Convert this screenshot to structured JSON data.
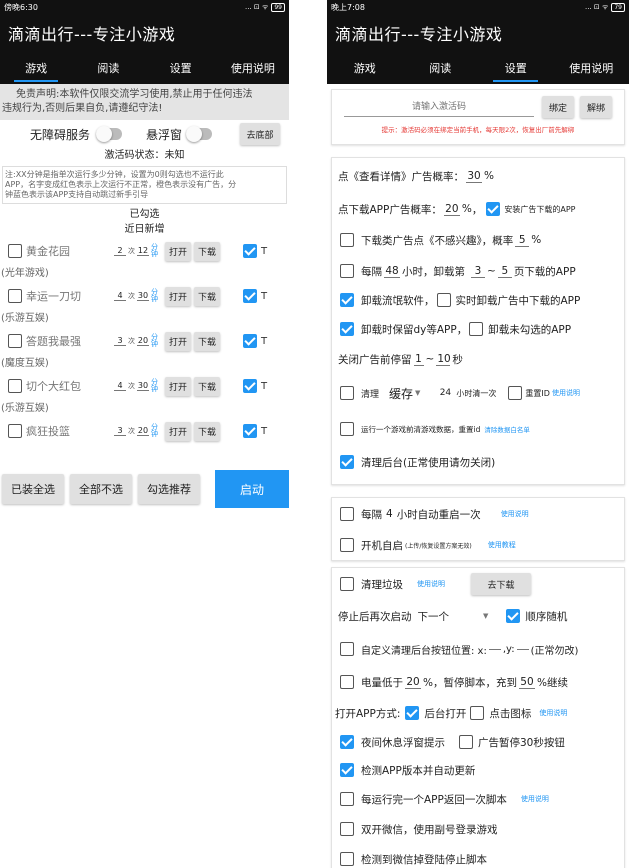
{
  "left": {
    "status_time": "傍晚6:30",
    "status_icons": "... ⊡ ᯤ",
    "status_battery": "99",
    "title": "滴滴出行---专注小游戏",
    "tabs": [
      "游戏",
      "阅读",
      "设置",
      "使用说明"
    ],
    "declaration_line1": "免责声明:本软件仅限交流学习使用,禁止用于任何违法",
    "declaration_line2": "违规行为,否则后果自负,请遵纪守法!",
    "accessibility_label": "无障碍服务",
    "float_window_label": "悬浮窗",
    "to_bottom_button": "去底部",
    "activation_status": "激活码状态：未知",
    "note_line1": "注:XX分钟是指单次运行多少分钟，设置为0则勾选也不运行此",
    "note_line2": "APP，名字变成红色表示上次运行不正常，橙色表示没有广告，分",
    "note_line3": "钟蓝色表示该APP支持自动跳过新手引导",
    "checked_label": "已勾选",
    "recent_label": "近日新增",
    "times_unit": "次",
    "minutes_unit": "分钟",
    "open_label": "打开",
    "download_label": "下载",
    "t_label": "T",
    "apps": [
      {
        "name": "黄金花园",
        "times": "2",
        "minutes": "12",
        "source": "(光年游戏)"
      },
      {
        "name": "幸运一刀切",
        "times": "4",
        "minutes": "30",
        "source": "(乐游互娱)"
      },
      {
        "name": "答题我最强",
        "times": "3",
        "minutes": "20",
        "source": "(魔度互娱)"
      },
      {
        "name": "切个大红包",
        "times": "4",
        "minutes": "30",
        "source": "(乐游互娱)"
      },
      {
        "name": "疯狂投篮",
        "times": "3",
        "minutes": "20",
        "source": ""
      }
    ],
    "bottom": {
      "select_installed": "已装全选",
      "deselect_all": "全部不选",
      "select_recommended": "勾选推荐",
      "start": "启动"
    }
  },
  "right": {
    "status_time": "晚上7:08",
    "status_icons": "... ⊡ ᯤ",
    "status_battery": "79",
    "title": "滴滴出行---专注小游戏",
    "tabs": [
      "游戏",
      "阅读",
      "设置",
      "使用说明"
    ],
    "activation_placeholder": "请输入激活码",
    "bind_button": "绑定",
    "unbind_button": "解绑",
    "activation_hint": "提示：激活码必须在绑定当前手机，每天限2次，恢复出厂前先解绑",
    "ad_prob_prefix": "点《查看详情》广告概率：",
    "ad_prob_value": "30",
    "percent": "%",
    "download_prob_prefix": "点下载APP广告概率：",
    "download_prob_value": "20",
    "install_ad_label": "安装广告下载的APP",
    "download_ad_prefix": "下载类广告点《不感兴趣》，概率",
    "download_ad_value": "5",
    "every_label": "每隔",
    "every_hours": "48",
    "hours_download_label": "小时，卸载第",
    "page_from": "3",
    "tilde": "~",
    "page_to": "5",
    "page_suffix": "页下载的APP",
    "uninstall_rogue": "卸载流氓软件，",
    "realtime_uninstall": "实时卸载广告中下载的APP",
    "keep_dy": "卸载时保留dy等APP，",
    "uninstall_unchecked": "卸载未勾选的APP",
    "close_ad_prefix": "关闭广告前停留",
    "close_ad_from": "1",
    "close_ad_to": "10",
    "close_ad_suffix": "秒",
    "clean_label": "清理",
    "cache_option": "缓存",
    "clean_interval": "24",
    "clean_interval_suffix": "小时清一次",
    "reset_id": "重置ID",
    "usage_link": "使用说明",
    "clear_data_label": "运行一个游戏前清游戏数据，重置id",
    "clear_whitelist_link": "清除数据白名单",
    "clean_background": "清理后台(正常使用请勿关闭)",
    "restart_every_prefix": "每隔",
    "restart_hours": "4",
    "restart_suffix": "小时自动重启一次",
    "autostart_label": "开机自启",
    "autostart_note": "(上传/恢复设置方案无效)",
    "usage_tutorial_link": "使用教程",
    "junk_clean": "清理垃圾",
    "go_download": "去下载",
    "stop_restart_prefix": "停止后再次启动",
    "next_option": "下一个",
    "order_random": "顺序随机",
    "custom_clean_prefix": "自定义清理后台按钮位置: x:",
    "custom_clean_y": ",y:",
    "custom_clean_suffix": "(正常勿改)",
    "battery_low_prefix": "电量低于",
    "battery_low_value": "20",
    "battery_low_mid": "%，暂停脚本，充到",
    "battery_charge_value": "50",
    "battery_low_suffix": "%继续",
    "open_app_mode": "打开APP方式:",
    "background_open": "后台打开",
    "click_icon": "点击图标",
    "night_rest_tip": "夜间休息浮窗提示",
    "ad_pause_30s": "广告暂停30秒按钮",
    "check_app_version": "检测APP版本并自动更新",
    "run_one_return": "每运行完一个APP返回一次脚本",
    "dual_wechat": "双开微信，使用副号登录游戏",
    "wechat_logout_stop": "检测到微信掉登陆停止脚本"
  }
}
